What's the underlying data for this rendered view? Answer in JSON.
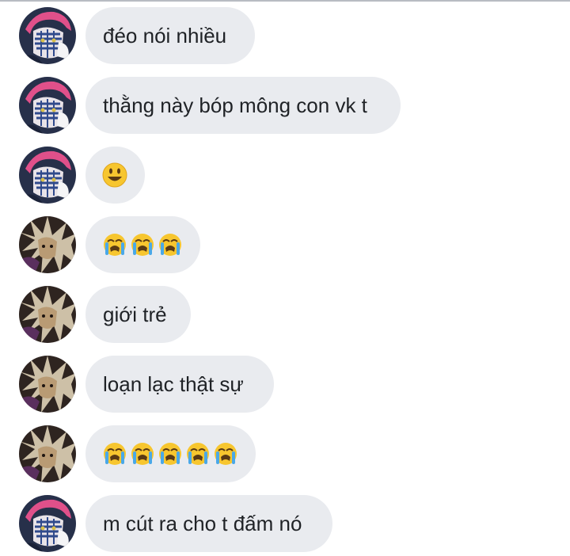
{
  "messages": [
    {
      "avatar": "pink-striped-character-avatar",
      "text": "đéo nói nhiều",
      "kind": "text"
    },
    {
      "avatar": "pink-striped-character-avatar",
      "text": "thằng này bóp mông con vk t",
      "kind": "text"
    },
    {
      "avatar": "pink-striped-character-avatar",
      "text": "😃",
      "kind": "emoji"
    },
    {
      "avatar": "dark-haired-character-avatar",
      "text": "😭😭😭",
      "kind": "emoji"
    },
    {
      "avatar": "dark-haired-character-avatar",
      "text": "giới trẻ",
      "kind": "text"
    },
    {
      "avatar": "dark-haired-character-avatar",
      "text": "loạn lạc thật sự",
      "kind": "text"
    },
    {
      "avatar": "dark-haired-character-avatar",
      "text": "😭😭😭😭😭",
      "kind": "emoji"
    },
    {
      "avatar": "pink-striped-character-avatar",
      "text": "m cút ra cho t đấm nó",
      "kind": "text"
    }
  ],
  "colors": {
    "bubble_background": "#e9ebef",
    "text": "#1f2226",
    "page_background": "#ffffff"
  }
}
